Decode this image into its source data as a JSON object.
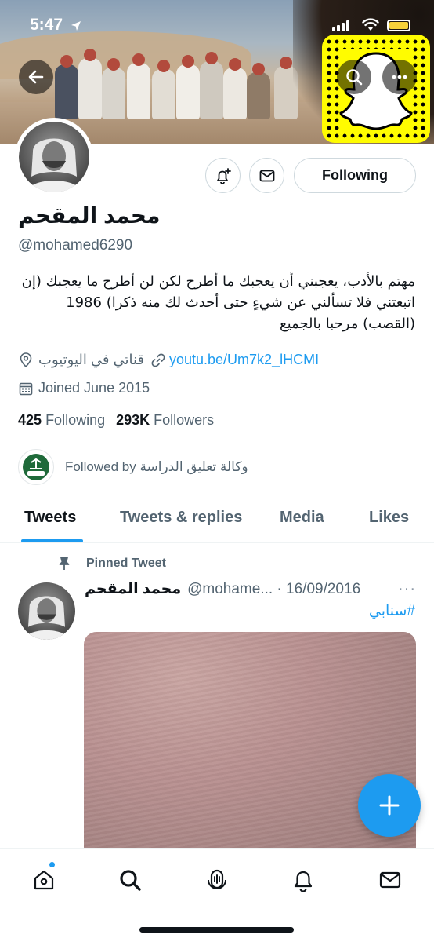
{
  "status_bar": {
    "time": "5:47"
  },
  "profile": {
    "display_name": "محمد المقحم",
    "handle": "@mohamed6290",
    "bio": "مهتم بالأدب، يعجبني أن يعجبك ما أطرح لكن لن أطرح ما يعجبك (إن اتبعتني فلا تسألني عن شيءٍ حتى أحدث لك منه ذكرا) 1986 (القصب) مرحبا بالجميع",
    "location": "قناتي في اليوتيوب",
    "link": "youtu.be/Um7k2_lHCMI",
    "joined": "Joined June 2015",
    "following_count": "425",
    "following_label": "Following",
    "followers_count": "293K",
    "followers_label": "Followers",
    "followed_by": "Followed by وكالة تعليق الدراسة"
  },
  "actions": {
    "following_button": "Following"
  },
  "tabs": [
    {
      "label": "Tweets",
      "active": true
    },
    {
      "label": "Tweets & replies",
      "active": false
    },
    {
      "label": "Media",
      "active": false
    },
    {
      "label": "Likes",
      "active": false
    }
  ],
  "pinned_tweet": {
    "pinned_label": "Pinned Tweet",
    "name": "محمد المقحم",
    "handle_date": "@mohame... · 16/09/2016",
    "more": "···",
    "text": "#سنابي"
  },
  "icons": {
    "back": "arrow-left-icon",
    "search": "search-icon",
    "more": "more-dots-icon",
    "notify": "bell-plus-icon",
    "message": "envelope-icon",
    "location": "map-pin-icon",
    "link": "link-icon",
    "calendar": "calendar-icon",
    "pin": "pin-icon",
    "compose": "plus-icon",
    "nav": [
      "home-icon",
      "search-icon",
      "spaces-icon",
      "bell-icon",
      "envelope-icon"
    ]
  },
  "colors": {
    "accent": "#1d9bf0",
    "snapcode": "#fffc00",
    "text": "#0f1419",
    "muted": "#536471"
  }
}
